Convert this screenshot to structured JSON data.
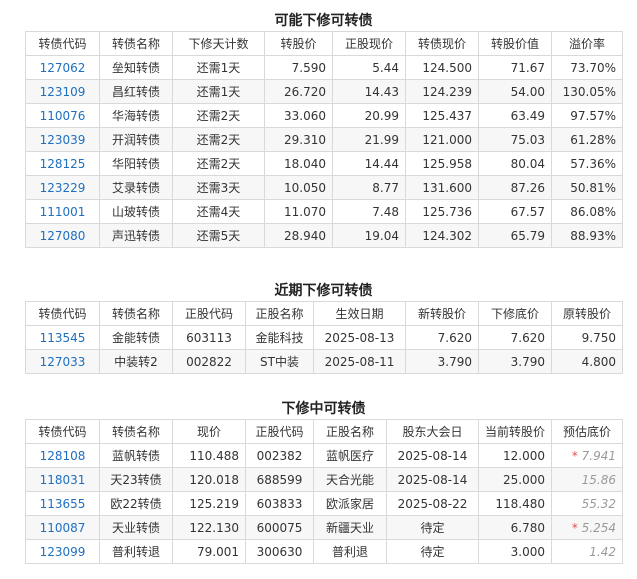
{
  "section1": {
    "title": "可能下修可转债",
    "headers": [
      "转债代码",
      "转债名称",
      "下修天计数",
      "转股价",
      "正股现价",
      "转债现价",
      "转股价值",
      "溢价率"
    ],
    "rows": [
      [
        "127062",
        "垒知转债",
        "还需1天",
        "7.590",
        "5.44",
        "124.500",
        "71.67",
        "73.70%"
      ],
      [
        "123109",
        "昌红转债",
        "还需1天",
        "26.720",
        "14.43",
        "124.239",
        "54.00",
        "130.05%"
      ],
      [
        "110076",
        "华海转债",
        "还需2天",
        "33.060",
        "20.99",
        "125.437",
        "63.49",
        "97.57%"
      ],
      [
        "123039",
        "开润转债",
        "还需2天",
        "29.310",
        "21.99",
        "121.000",
        "75.03",
        "61.28%"
      ],
      [
        "128125",
        "华阳转债",
        "还需2天",
        "18.040",
        "14.44",
        "125.958",
        "80.04",
        "57.36%"
      ],
      [
        "123229",
        "艾录转债",
        "还需3天",
        "10.050",
        "8.77",
        "131.600",
        "87.26",
        "50.81%"
      ],
      [
        "111001",
        "山玻转债",
        "还需4天",
        "11.070",
        "7.48",
        "125.736",
        "67.57",
        "86.08%"
      ],
      [
        "127080",
        "声迅转债",
        "还需5天",
        "28.940",
        "19.04",
        "124.302",
        "65.79",
        "88.93%"
      ]
    ]
  },
  "section2": {
    "title": "近期下修可转债",
    "headers": [
      "转债代码",
      "转债名称",
      "正股代码",
      "正股名称",
      "生效日期",
      "新转股价",
      "下修底价",
      "原转股价"
    ],
    "rows": [
      [
        "113545",
        "金能转债",
        "603113",
        "金能科技",
        "2025-08-13",
        "7.620",
        "7.620",
        "9.750"
      ],
      [
        "127033",
        "中装转2",
        "002822",
        "ST中装",
        "2025-08-11",
        "3.790",
        "3.790",
        "4.800"
      ]
    ]
  },
  "section3": {
    "title": "下修中可转债",
    "headers": [
      "转债代码",
      "转债名称",
      "现价",
      "正股代码",
      "正股名称",
      "股东大会日",
      "当前转股价",
      "预估底价"
    ],
    "rows": [
      [
        "128108",
        "蓝帆转债",
        "110.488",
        "002382",
        "蓝帆医疗",
        "2025-08-14",
        "12.000",
        "7.941"
      ],
      [
        "118031",
        "天23转债",
        "120.018",
        "688599",
        "天合光能",
        "2025-08-14",
        "25.000",
        "15.86"
      ],
      [
        "113655",
        "欧22转债",
        "125.219",
        "603833",
        "欧派家居",
        "2025-08-22",
        "118.480",
        "55.32"
      ],
      [
        "110087",
        "天业转债",
        "122.130",
        "600075",
        "新疆天业",
        "待定",
        "6.780",
        "5.254"
      ],
      [
        "123099",
        "普利转退",
        "79.001",
        "300630",
        "普利退",
        "待定",
        "3.000",
        "1.42"
      ]
    ],
    "starred_rows": [
      0,
      3
    ],
    "star_glyph": "*"
  }
}
